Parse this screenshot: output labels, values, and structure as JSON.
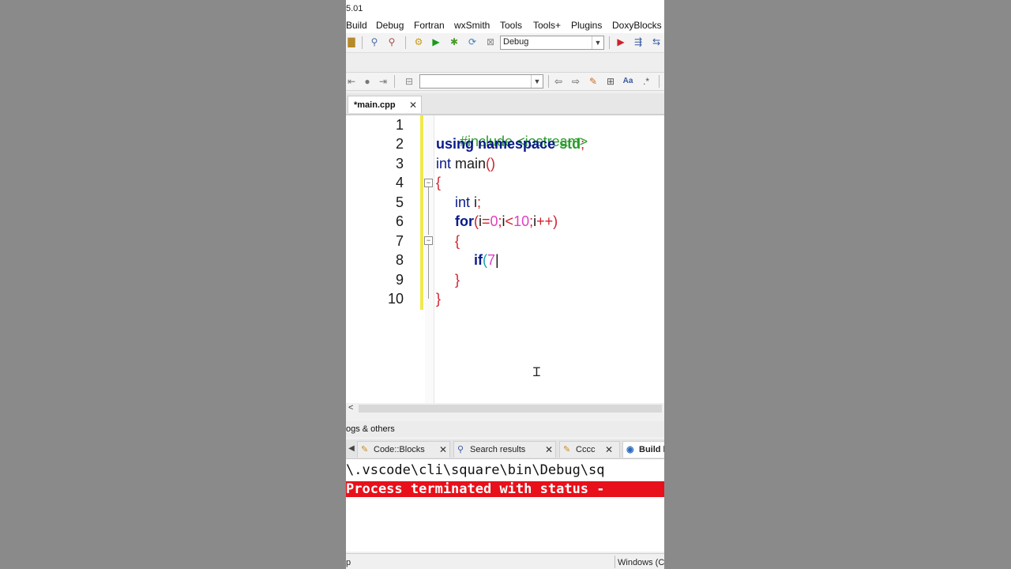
{
  "window": {
    "title_fragment": "5.01"
  },
  "menu": {
    "items": [
      "Build",
      "Debug",
      "Fortran",
      "wxSmith",
      "Tools",
      "Tools+",
      "Plugins",
      "DoxyBlocks"
    ]
  },
  "toolbar": {
    "build_target": "Debug",
    "symbol_combo": ""
  },
  "editor": {
    "file_tab": "*main.cpp",
    "close_glyph": "✕",
    "line_numbers": [
      "1",
      "2",
      "3",
      "4",
      "5",
      "6",
      "7",
      "8",
      "9",
      "10"
    ],
    "lines": {
      "l1_pp": "#include <iostream>",
      "l2_kw1": "using",
      "l2_kw2": "namespace",
      "l2_std": "std",
      "l2_semi": ";",
      "l3_type": "int",
      "l3_name": " main",
      "l3_parens": "()",
      "l4_brace": "{",
      "l5_type": "int",
      "l5_rest": " i",
      "l5_semi": ";",
      "l6_kw": "for",
      "l6_p1": "(",
      "l6_i1": "i",
      "l6_eq": "=",
      "l6_n0": "0",
      "l6_s1": ";",
      "l6_i2": "i",
      "l6_lt": "<",
      "l6_n10": "10",
      "l6_s2": ";",
      "l6_i3": "i",
      "l6_pp": "++",
      "l6_p2": ")",
      "l7_brace": "{",
      "l8_kw": "if",
      "l8_p": "(",
      "l8_n": "7",
      "l8_cursor": "|",
      "l9_brace": "}",
      "l10_brace": "}"
    }
  },
  "logs": {
    "title": "ogs & others",
    "tabs": [
      {
        "label": "Code::Blocks"
      },
      {
        "label": "Search results"
      },
      {
        "label": "Cccc"
      },
      {
        "label": "Build l"
      }
    ],
    "line1": "\\.vscode\\cli\\square\\bin\\Debug\\sq",
    "line2": "Process terminated with status -"
  },
  "status": {
    "left": "p",
    "right": "Windows (C"
  },
  "colors": {
    "keyword": "#0a1a8a",
    "preprocessor": "#2c9c2c",
    "operator": "#d0202a",
    "number": "#e040c0",
    "error_bg": "#e8101a",
    "change_bar": "#f2e84a"
  }
}
